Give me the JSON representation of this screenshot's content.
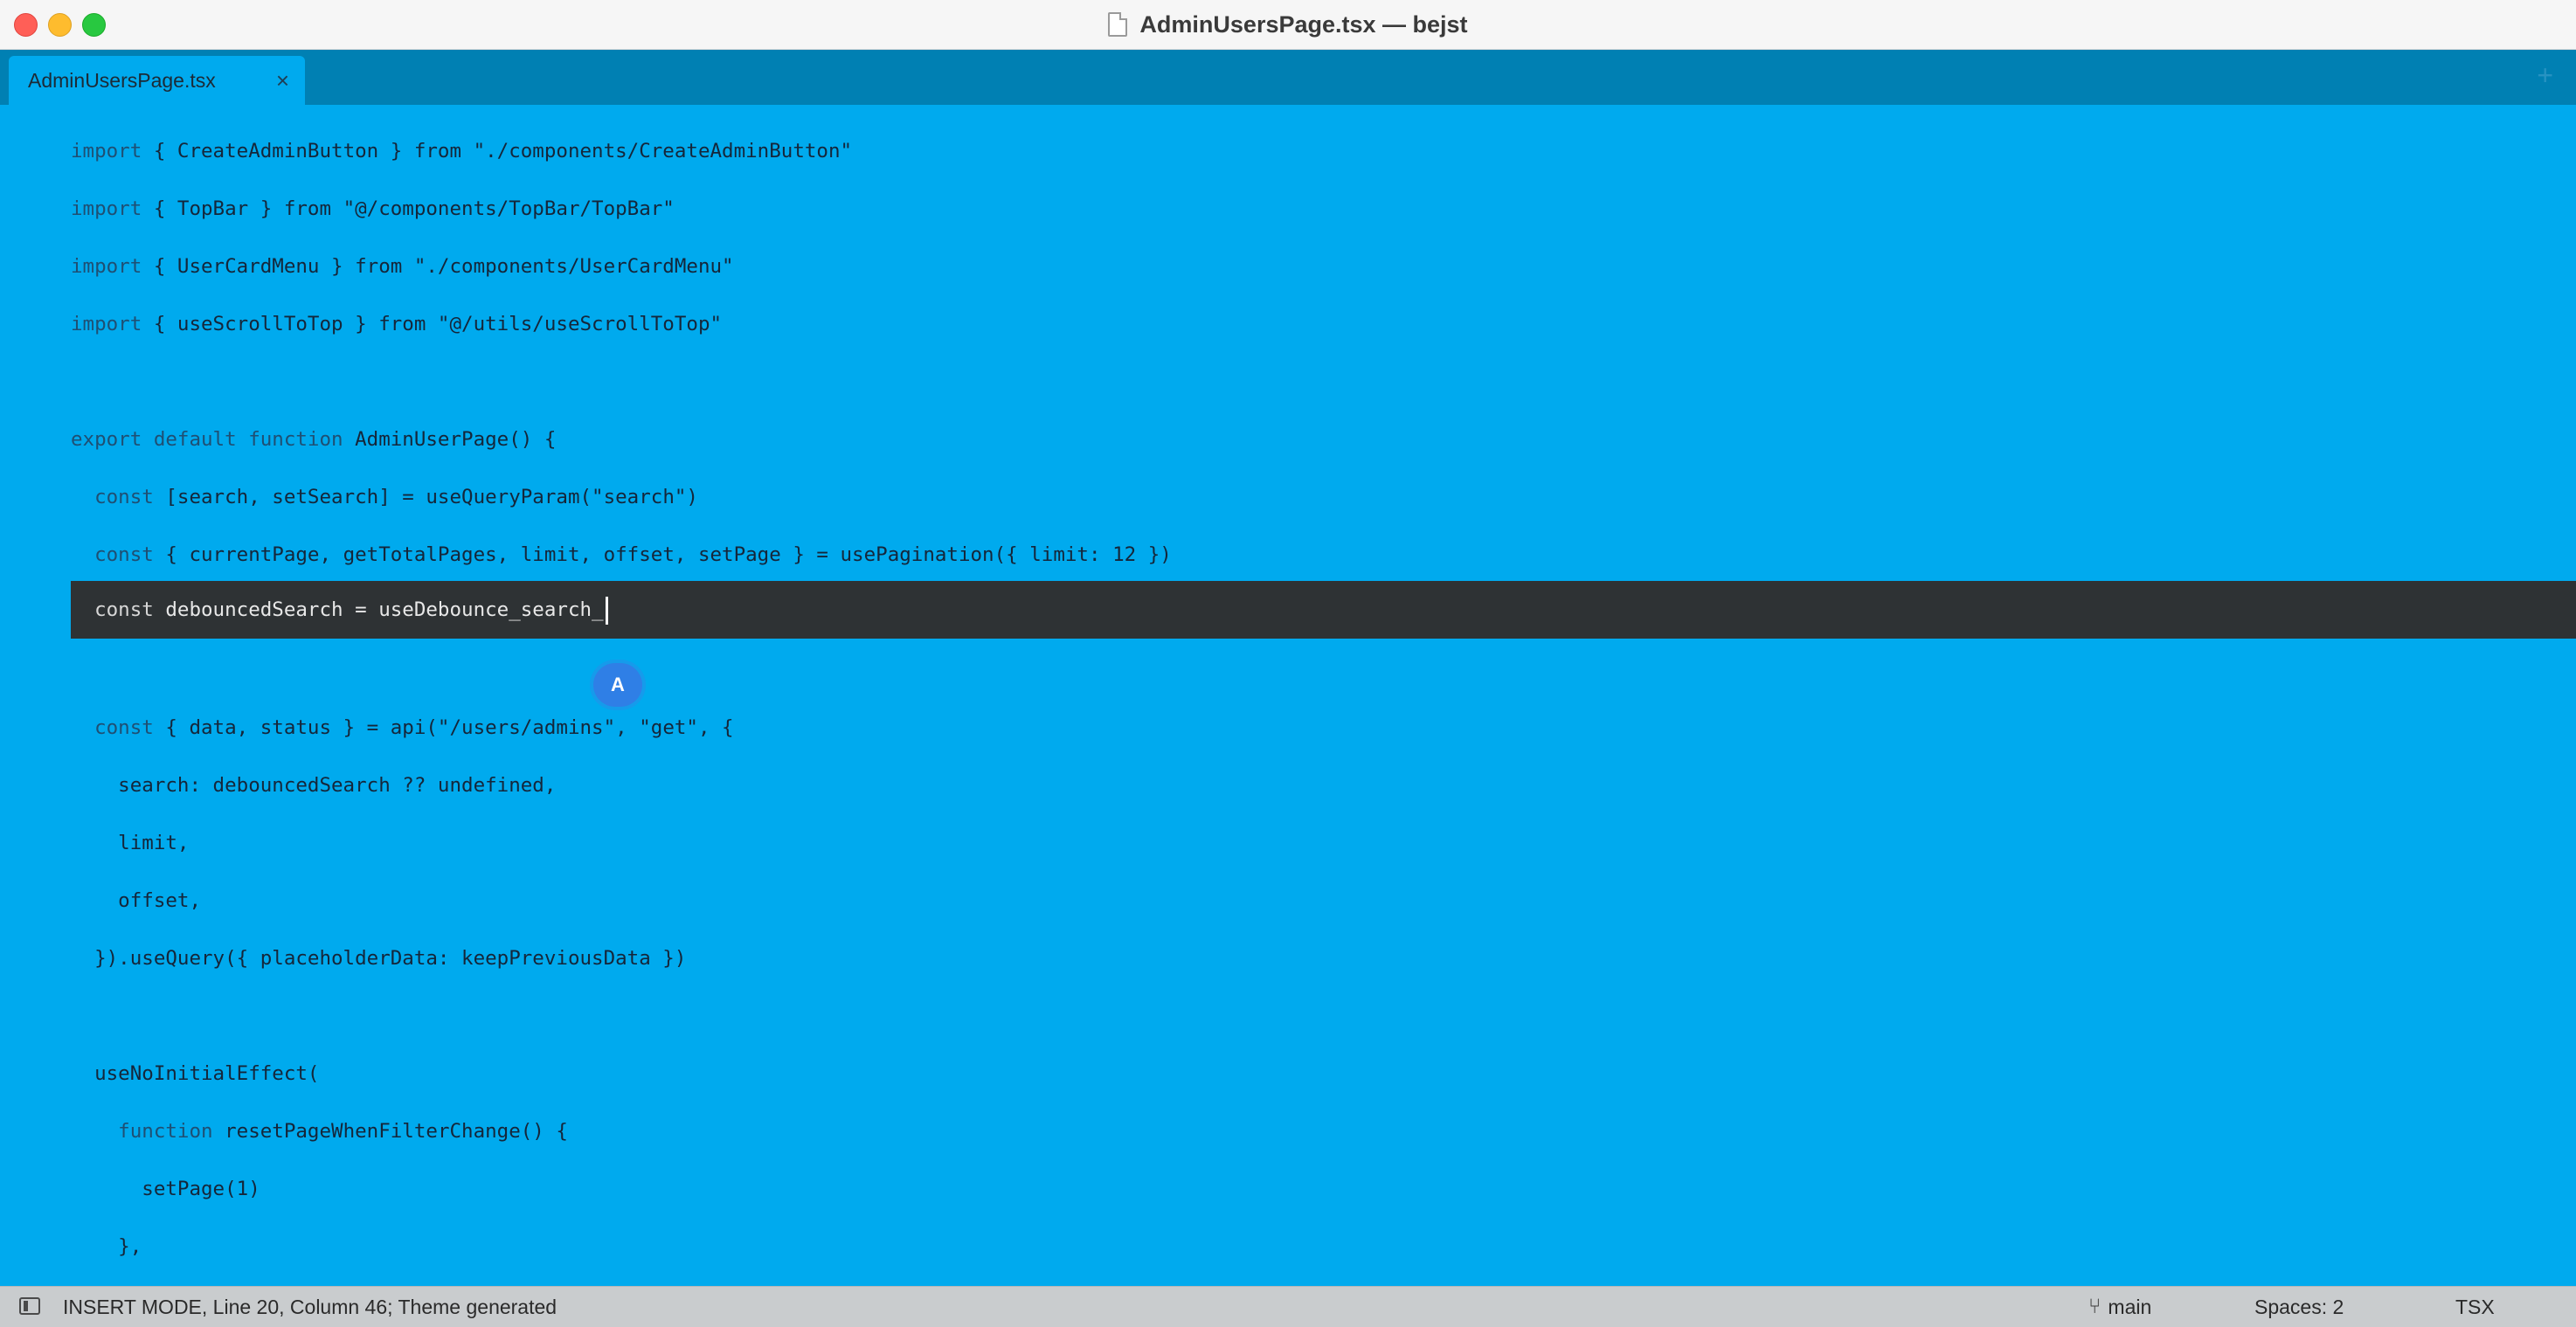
{
  "window": {
    "title": "AdminUsersPage.tsx — bejst"
  },
  "tabs": [
    {
      "label": "AdminUsersPage.tsx",
      "close": "×"
    }
  ],
  "tab_add": "+",
  "editor": {
    "lines": [
      {
        "prefix": "import ",
        "text": "{ CreateAdminButton } from \"./components/CreateAdminButton\""
      },
      {
        "prefix": "import ",
        "text": "{ TopBar } from \"@/components/TopBar/TopBar\""
      },
      {
        "prefix": "import ",
        "text": "{ UserCardMenu } from \"./components/UserCardMenu\""
      },
      {
        "prefix": "import ",
        "text": "{ useScrollToTop } from \"@/utils/useScrollToTop\""
      },
      {
        "prefix": "",
        "text": ""
      },
      {
        "prefix": "export default function ",
        "text": "AdminUserPage() {"
      },
      {
        "prefix": "  const ",
        "text": "[search, setSearch] = useQueryParam(\"search\")"
      },
      {
        "prefix": "  const ",
        "text": "{ currentPage, getTotalPages, limit, offset, setPage } = usePagination({ limit: 12 })"
      },
      {
        "prefix": "  const ",
        "text": "debouncedSearch = useDebounce_search_"
      },
      {
        "prefix": "",
        "text": ""
      },
      {
        "prefix": "  const ",
        "text": "{ data, status } = api(\"/users/admins\", \"get\", {"
      },
      {
        "prefix": "",
        "text": "    search: debouncedSearch ?? undefined,"
      },
      {
        "prefix": "",
        "text": "    limit,"
      },
      {
        "prefix": "",
        "text": "    offset,"
      },
      {
        "prefix": "",
        "text": "  }).useQuery({ placeholderData: keepPreviousData })"
      },
      {
        "prefix": "",
        "text": ""
      },
      {
        "prefix": "",
        "text": "  useNoInitialEffect("
      },
      {
        "prefix": "    function ",
        "text": "resetPageWhenFilterChange() {"
      },
      {
        "prefix": "",
        "text": "      setPage(1)"
      },
      {
        "prefix": "",
        "text": "    },"
      }
    ],
    "current_line_index": 8,
    "collaborator_initial": "A"
  },
  "statusbar": {
    "mode_text": "INSERT MODE, Line 20, Column 46; Theme generated",
    "branch": "main",
    "spaces": "Spaces: 2",
    "syntax": "TSX"
  },
  "icons": {
    "file": "document-icon",
    "sidebar": "sidebar-toggle-icon",
    "branch": "git-branch-icon"
  },
  "colors": {
    "editor_bg": "#00aaee",
    "tabbar_bg": "#0080b3",
    "current_line_bg": "#2e3234",
    "statusbar_bg": "#c9ccce",
    "collaborator": "#2f7fe6"
  }
}
